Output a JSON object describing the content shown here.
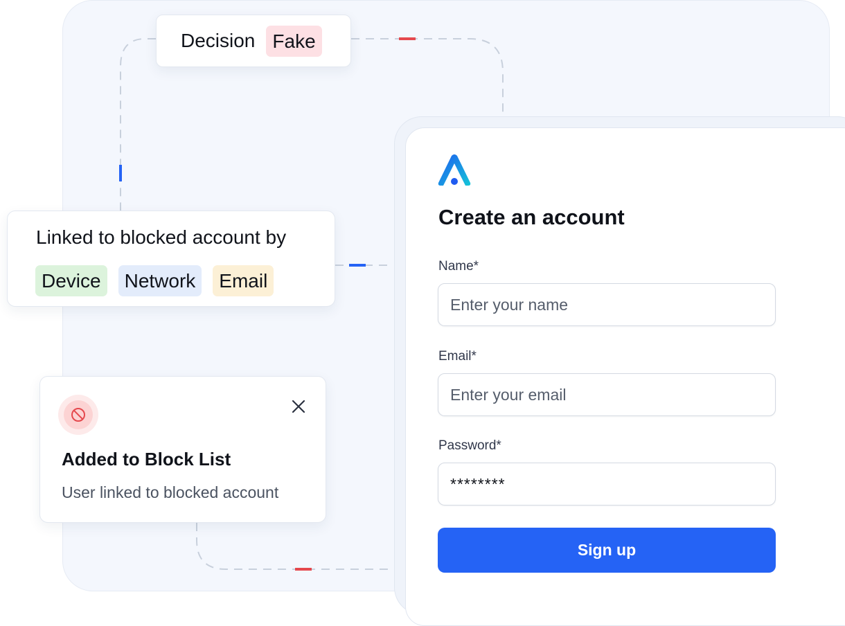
{
  "decision": {
    "label": "Decision",
    "verdict": "Fake"
  },
  "linked": {
    "title": "Linked to blocked account by",
    "tags": [
      "Device",
      "Network",
      "Email"
    ]
  },
  "toast": {
    "icon": "ban-icon",
    "title": "Added to Block List",
    "message": "User linked to blocked account"
  },
  "form": {
    "title": "Create an account",
    "name_label": "Name*",
    "name_placeholder": "Enter your name",
    "email_label": "Email*",
    "email_placeholder": "Enter your email",
    "password_label": "Password*",
    "password_value": "********",
    "submit_label": "Sign up"
  },
  "colors": {
    "accent": "#2563f5",
    "fake_bg": "#fde0e4",
    "device_bg": "#dcf3dc",
    "network_bg": "#e3ecfb",
    "email_bg": "#fcf0d6"
  }
}
